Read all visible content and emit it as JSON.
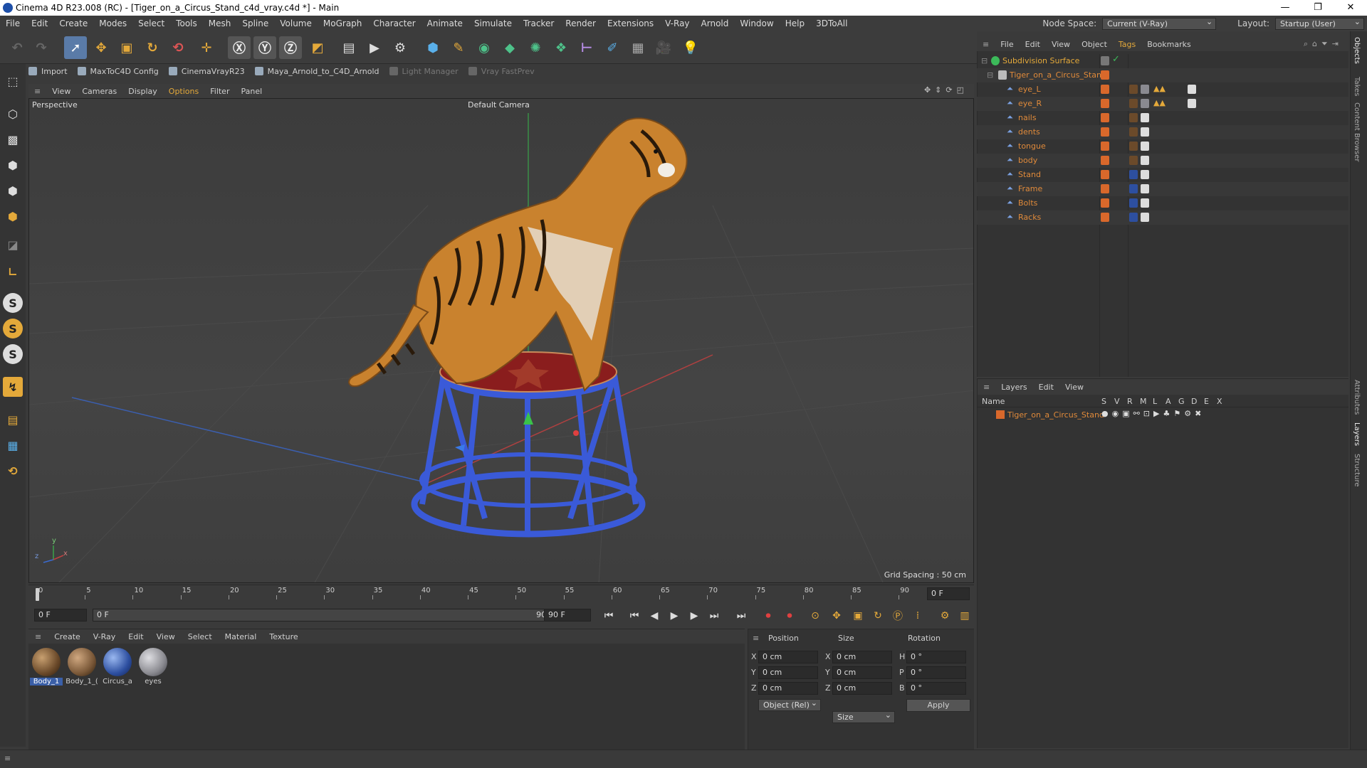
{
  "window": {
    "title": "Cinema 4D R23.008 (RC) - [Tiger_on_a_Circus_Stand_c4d_vray.c4d *] - Main",
    "minimize": "—",
    "maximize": "❐",
    "close": "✕"
  },
  "menubar": {
    "items": [
      "File",
      "Edit",
      "Create",
      "Modes",
      "Select",
      "Tools",
      "Mesh",
      "Spline",
      "Volume",
      "MoGraph",
      "Character",
      "Animate",
      "Simulate",
      "Tracker",
      "Render",
      "Extensions",
      "V-Ray",
      "Arnold",
      "Window",
      "Help",
      "3DToAll"
    ],
    "node_space_label": "Node Space:",
    "node_space_value": "Current (V-Ray)",
    "layout_label": "Layout:",
    "layout_value": "Startup (User)"
  },
  "pluginbar": {
    "items": [
      "Import",
      "MaxToC4D Config",
      "CinemaVrayR23",
      "Maya_Arnold_to_C4D_Arnold",
      "Light Manager",
      "Vray FastPrev"
    ]
  },
  "viewport": {
    "menu": [
      "View",
      "Cameras",
      "Display",
      "Options",
      "Filter",
      "Panel"
    ],
    "label": "Perspective",
    "camera": "Default Camera",
    "grid_spacing": "Grid Spacing : 50 cm",
    "axis_y": "y",
    "axis_x": "x",
    "axis_z": "z"
  },
  "timeline": {
    "ticks": [
      "0",
      "5",
      "10",
      "15",
      "20",
      "25",
      "30",
      "35",
      "40",
      "45",
      "50",
      "55",
      "60",
      "65",
      "70",
      "75",
      "80",
      "85",
      "90"
    ],
    "current_frame": "0 F",
    "start": "0 F",
    "min": "0 F",
    "max_field": "90 F",
    "end": "90 F"
  },
  "materials": {
    "menu": [
      "Create",
      "V-Ray",
      "Edit",
      "View",
      "Select",
      "Material",
      "Texture"
    ],
    "items": [
      {
        "name": "Body_1",
        "color": "#6b4a2a"
      },
      {
        "name": "Body_1_(",
        "color": "#7a5838"
      },
      {
        "name": "Circus_a",
        "color": "#2d4fa0"
      },
      {
        "name": "eyes",
        "color": "#8a8a90"
      }
    ]
  },
  "coords": {
    "headers": [
      "Position",
      "Size",
      "Rotation"
    ],
    "px": "0 cm",
    "py": "0 cm",
    "pz": "0 cm",
    "sx": "0 cm",
    "sy": "0 cm",
    "sz": "0 cm",
    "rh": "0 °",
    "rp": "0 °",
    "rb": "0 °",
    "lx": "X",
    "ly": "Y",
    "lz": "Z",
    "lh": "H",
    "lp": "P",
    "lb": "B",
    "mode": "Object (Rel)",
    "size_mode": "Size",
    "apply": "Apply"
  },
  "objects": {
    "menu": [
      "File",
      "Edit",
      "View",
      "Object",
      "Tags",
      "Bookmarks"
    ],
    "root": "Subdivision Surface",
    "group": "Tiger_on_a_Circus_Stand",
    "children": [
      "eye_L",
      "eye_R",
      "nails",
      "dents",
      "tongue",
      "body",
      "Stand",
      "Frame",
      "Bolts",
      "Racks"
    ]
  },
  "layers": {
    "menu": [
      "Layers",
      "Edit",
      "View"
    ],
    "col_name": "Name",
    "cols": [
      "S",
      "V",
      "R",
      "M",
      "L",
      "A",
      "G",
      "D",
      "E",
      "X"
    ],
    "row": "Tiger_on_a_Circus_Stand"
  },
  "right_tabs": [
    "Objects",
    "Takes",
    "Content Browser",
    "Attributes",
    "Layers",
    "Structure"
  ],
  "colors": {
    "accent": "#e08a3a",
    "layer": "#d9682b",
    "stand_blue": "#3a5ad8",
    "stand_red": "#8a1d1d"
  }
}
